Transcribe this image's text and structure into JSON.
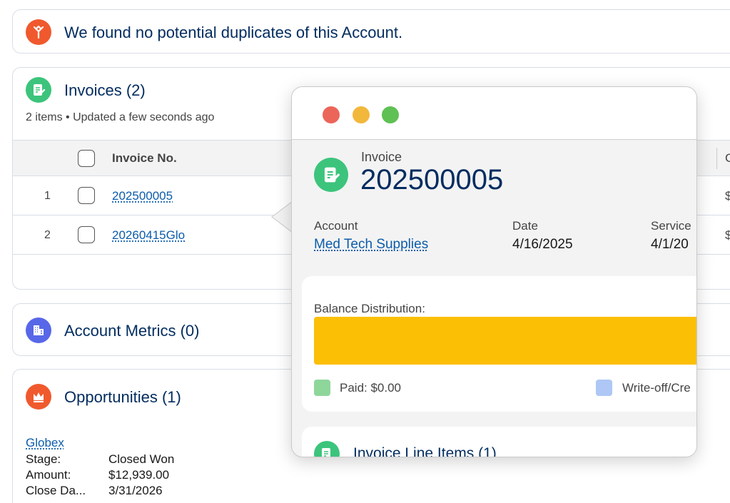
{
  "duplicates": {
    "icon": "merge-icon",
    "message": "We found no potential duplicates of this Account.",
    "accent": "#f0592d"
  },
  "invoices": {
    "title": "Invoices (2)",
    "subtitle": "2 items • Updated a few seconds ago",
    "icon": "invoice-icon",
    "columns": {
      "invoice_no": "Invoice No.",
      "right_header": "C"
    },
    "rows": [
      {
        "num": "1",
        "invoice_no": "202500005",
        "right": "$"
      },
      {
        "num": "2",
        "invoice_no": "20260415Glo",
        "right": "$"
      }
    ]
  },
  "account_metrics": {
    "title": "Account Metrics (0)",
    "icon": "building-icon",
    "accent": "#5867e8"
  },
  "opportunities": {
    "title": "Opportunities (1)",
    "icon": "crown-icon",
    "record_name": "Globex",
    "fields": [
      {
        "label": "Stage:",
        "value": "Closed Won"
      },
      {
        "label": "Amount:",
        "value": "$12,939.00"
      },
      {
        "label": "Close Da...",
        "value": "3/31/2026"
      }
    ]
  },
  "popover": {
    "kind": "Invoice",
    "number": "202500005",
    "fields": [
      {
        "label": "Account",
        "value": "Med Tech Supplies",
        "link": true
      },
      {
        "label": "Date",
        "value": "4/16/2025",
        "link": false
      },
      {
        "label": "Service",
        "value": "4/1/20",
        "link": false
      }
    ],
    "balance": {
      "title": "Balance Distribution:",
      "bar_color": "#fbbf06",
      "legend": [
        {
          "label": "Paid: $0.00",
          "color": "#8fd69b"
        },
        {
          "label": "Write-off/Cre",
          "color": "#aec7f5"
        }
      ]
    },
    "line_items_title": "Invoice Line Items (1)"
  }
}
